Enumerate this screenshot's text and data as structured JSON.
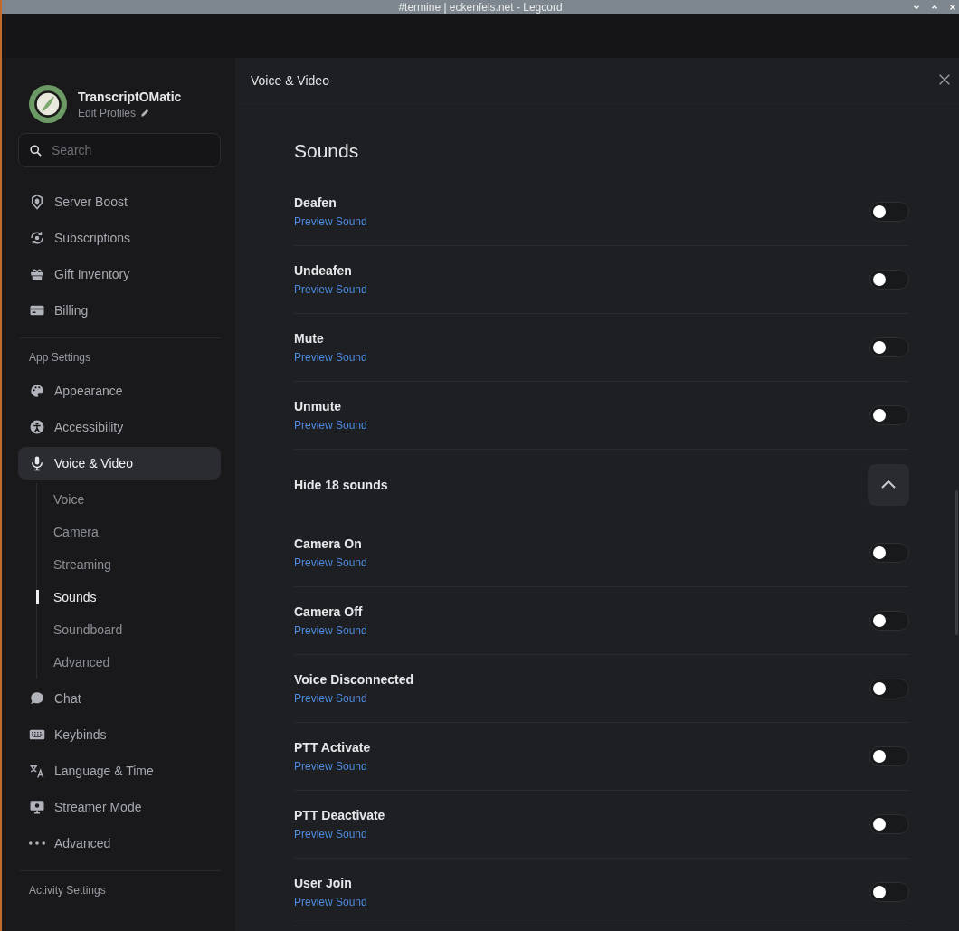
{
  "window": {
    "title": "#termine | eckenfels.net - Legcord"
  },
  "profile": {
    "name": "TranscriptOMatic",
    "action": "Edit Profiles"
  },
  "search": {
    "placeholder": "Search"
  },
  "sidebar": {
    "sections": [
      {
        "items": [
          {
            "label": "Server Boost",
            "selected": false
          },
          {
            "label": "Subscriptions",
            "selected": false
          },
          {
            "label": "Gift Inventory",
            "selected": false
          },
          {
            "label": "Billing",
            "selected": false
          }
        ]
      },
      {
        "heading": "App Settings",
        "items": [
          {
            "label": "Appearance",
            "selected": false
          },
          {
            "label": "Accessibility",
            "selected": false
          },
          {
            "label": "Voice & Video",
            "selected": true,
            "children": [
              {
                "label": "Voice",
                "selected": false
              },
              {
                "label": "Camera",
                "selected": false
              },
              {
                "label": "Streaming",
                "selected": false
              },
              {
                "label": "Sounds",
                "selected": true
              },
              {
                "label": "Soundboard",
                "selected": false
              },
              {
                "label": "Advanced",
                "selected": false
              }
            ]
          },
          {
            "label": "Chat",
            "selected": false
          },
          {
            "label": "Keybinds",
            "selected": false
          },
          {
            "label": "Language & Time",
            "selected": false
          },
          {
            "label": "Streamer Mode",
            "selected": false
          },
          {
            "label": "Advanced",
            "selected": false
          }
        ]
      },
      {
        "heading": "Activity Settings"
      }
    ]
  },
  "content": {
    "header": "Voice & Video",
    "heading": "Sounds",
    "rows": [
      {
        "kind": "sound",
        "name": "Deafen",
        "link": "Preview Sound",
        "on": false
      },
      {
        "kind": "sound",
        "name": "Undeafen",
        "link": "Preview Sound",
        "on": false
      },
      {
        "kind": "sound",
        "name": "Mute",
        "link": "Preview Sound",
        "on": false
      },
      {
        "kind": "sound",
        "name": "Unmute",
        "link": "Preview Sound",
        "on": false
      },
      {
        "kind": "collapse",
        "label": "Hide 18 sounds",
        "expanded": true
      },
      {
        "kind": "sound",
        "name": "Camera On",
        "link": "Preview Sound",
        "on": false
      },
      {
        "kind": "sound",
        "name": "Camera Off",
        "link": "Preview Sound",
        "on": false
      },
      {
        "kind": "sound",
        "name": "Voice Disconnected",
        "link": "Preview Sound",
        "on": false
      },
      {
        "kind": "sound",
        "name": "PTT Activate",
        "link": "Preview Sound",
        "on": false
      },
      {
        "kind": "sound",
        "name": "PTT Deactivate",
        "link": "Preview Sound",
        "on": false
      },
      {
        "kind": "sound",
        "name": "User Join",
        "link": "Preview Sound",
        "on": false
      }
    ]
  }
}
